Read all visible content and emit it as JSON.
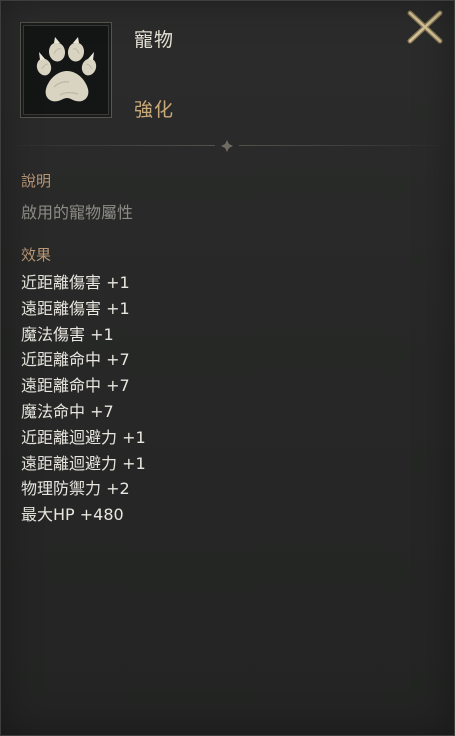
{
  "tooltip": {
    "icon": "paw-icon",
    "item_name": "寵物",
    "item_grade": "強化",
    "close_icon": "close-icon",
    "description": {
      "label": "說明",
      "text": "啟用的寵物屬性"
    },
    "effects": {
      "label": "效果",
      "items": [
        "近距離傷害 +1",
        "遠距離傷害 +1",
        "魔法傷害 +1",
        "近距離命中 +7",
        "遠距離命中 +7",
        "魔法命中 +7",
        "近距離迴避力 +1",
        "遠距離迴避力 +1",
        "物理防禦力 +2",
        "最大HP +480"
      ]
    },
    "colors": {
      "panel_background": "#272827",
      "name_text": "#e6e2d6",
      "grade_text": "#c9a978",
      "section_label": "#b99776",
      "description_text": "#8d8b86",
      "effect_text": "#e8e6df",
      "close_icon": "#c7b386"
    }
  }
}
